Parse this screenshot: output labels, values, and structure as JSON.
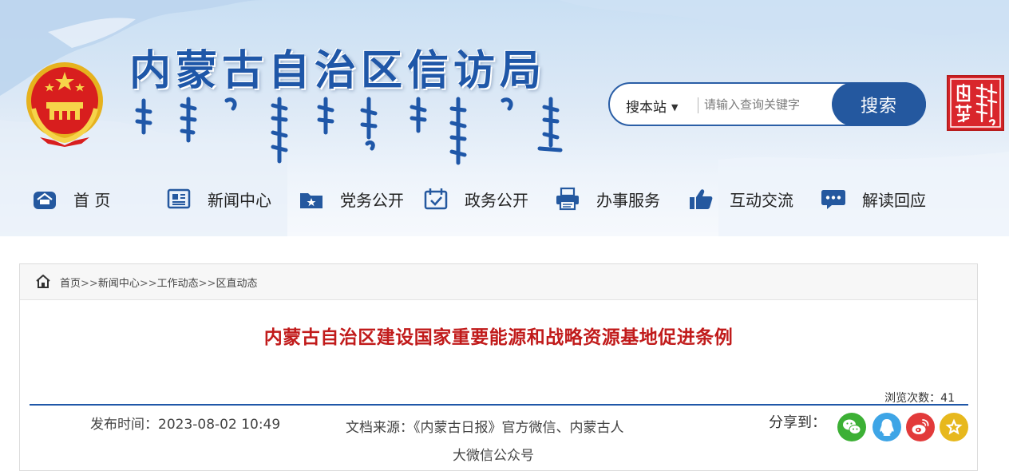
{
  "header": {
    "site_title": "内蒙古自治区信访局",
    "search": {
      "scope_label": "搜本站",
      "placeholder": "请输入查询关键字",
      "button_label": "搜索"
    }
  },
  "nav": {
    "items": [
      {
        "label": "首 页",
        "icon": "home-icon"
      },
      {
        "label": "新闻中心",
        "icon": "newspaper-icon"
      },
      {
        "label": "党务公开",
        "icon": "folder-star-icon"
      },
      {
        "label": "政务公开",
        "icon": "calendar-check-icon"
      },
      {
        "label": "办事服务",
        "icon": "printer-icon"
      },
      {
        "label": "互动交流",
        "icon": "thumbs-up-icon"
      },
      {
        "label": "解读回应",
        "icon": "chat-bubble-icon"
      }
    ]
  },
  "breadcrumb": {
    "items": [
      "首页",
      "新闻中心",
      "工作动态",
      "区直动态"
    ],
    "separator": ">>"
  },
  "article": {
    "title": "内蒙古自治区建设国家重要能源和战略资源基地促进条例",
    "view_count_text": "浏览次数：41",
    "publish_time_text": "发布时间：2023-08-02 10:49",
    "source_line1": "文档来源：《内蒙古日报》官方微信、内蒙古人",
    "source_line2": "大微信公众号",
    "share_label": "分享到："
  },
  "share": {
    "items": [
      {
        "name": "wechat",
        "color": "#3cb035"
      },
      {
        "name": "qq",
        "color": "#3ea5e6"
      },
      {
        "name": "weibo",
        "color": "#e23a3a"
      },
      {
        "name": "qzone",
        "color": "#e7b81d"
      }
    ]
  },
  "colors": {
    "brand_blue": "#1f57a8",
    "title_red": "#c11b1b",
    "seal_red": "#d9262c"
  }
}
